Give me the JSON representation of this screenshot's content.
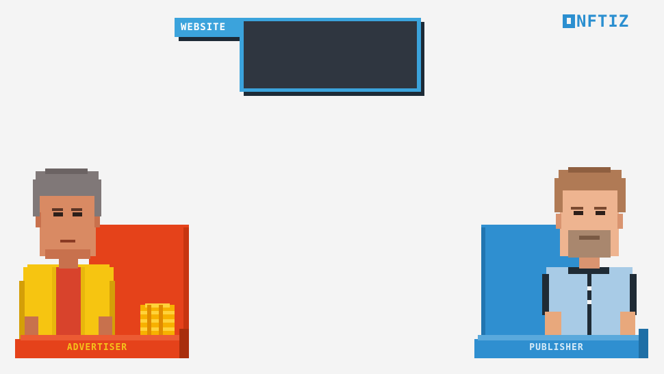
{
  "website_panel": {
    "label": "WEBSITE"
  },
  "logo": {
    "text": "NFTIZ"
  },
  "advertiser": {
    "label": "ADVERTISER",
    "accent": "#e5421a"
  },
  "publisher": {
    "label": "PUBLISHER",
    "accent": "#2f8fd0"
  },
  "colors": {
    "background": "#f4f4f4",
    "website_blue": "#3ba3dc",
    "screen_dark": "#2f3640",
    "advertiser_label_text": "#f5c21b",
    "publisher_label_text": "#d8ecf8"
  },
  "icons": [
    "coin-stack-icon",
    "nftiz-logo-icon"
  ]
}
